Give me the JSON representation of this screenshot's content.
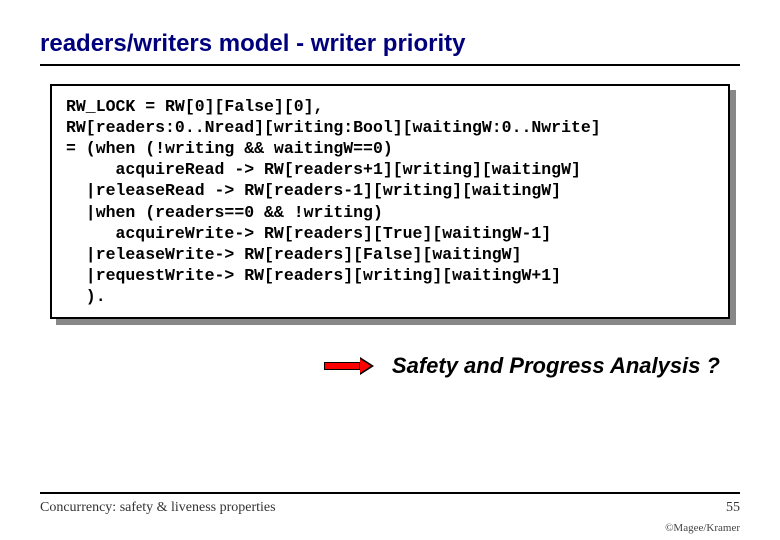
{
  "title": "readers/writers model - writer priority",
  "code": "RW_LOCK = RW[0][False][0],\nRW[readers:0..Nread][writing:Bool][waitingW:0..Nwrite]\n= (when (!writing && waitingW==0)\n     acquireRead -> RW[readers+1][writing][waitingW]\n  |releaseRead -> RW[readers-1][writing][waitingW]\n  |when (readers==0 && !writing)\n     acquireWrite-> RW[readers][True][waitingW-1]\n  |releaseWrite-> RW[readers][False][waitingW]\n  |requestWrite-> RW[readers][writing][waitingW+1]\n  ).",
  "callout": "Safety and Progress Analysis ?",
  "footer_left": "Concurrency: safety & liveness properties",
  "footer_right": "55",
  "copyright": "©Magee/Kramer"
}
